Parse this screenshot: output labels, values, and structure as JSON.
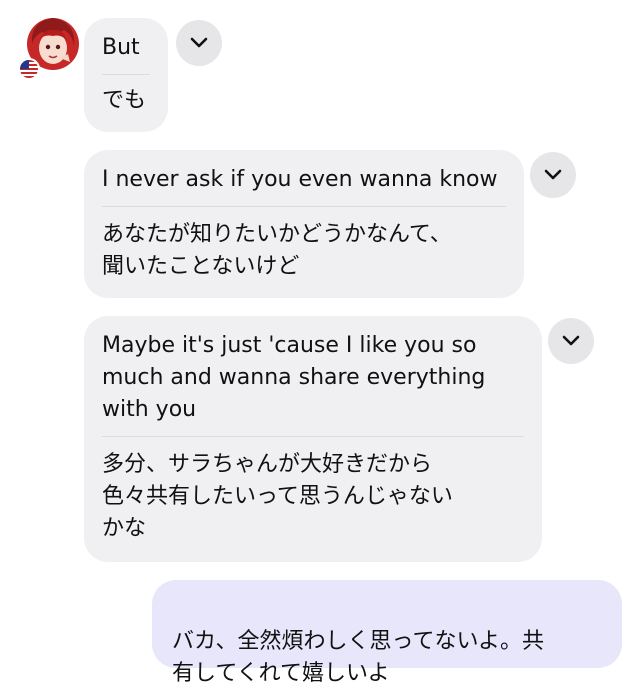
{
  "messages": [
    {
      "original": "But",
      "translation": "でも"
    },
    {
      "original": "I never ask if you even wanna know",
      "translation": "あなたが知りたいかどうかなんて、\n聞いたことないけど"
    },
    {
      "original": "Maybe it's just 'cause I like you so\nmuch and wanna share everything\nwith you",
      "translation": "多分、サラちゃんが大好きだから\n色々共有したいって思うんじゃない\nかな"
    }
  ],
  "reply": {
    "text": "バカ、全然煩わしく思ってないよ。共\n有してくれて嬉しいよ"
  },
  "icons": {
    "avatar": "avatar-red-hair-character",
    "flag": "us-flag-icon",
    "chevron": "chevron-down-icon"
  },
  "colors": {
    "incoming_bubble": "#f0f0f2",
    "outgoing_bubble": "#e8e6fb",
    "chevron_bg": "#e6e6e9",
    "text": "#111111"
  }
}
